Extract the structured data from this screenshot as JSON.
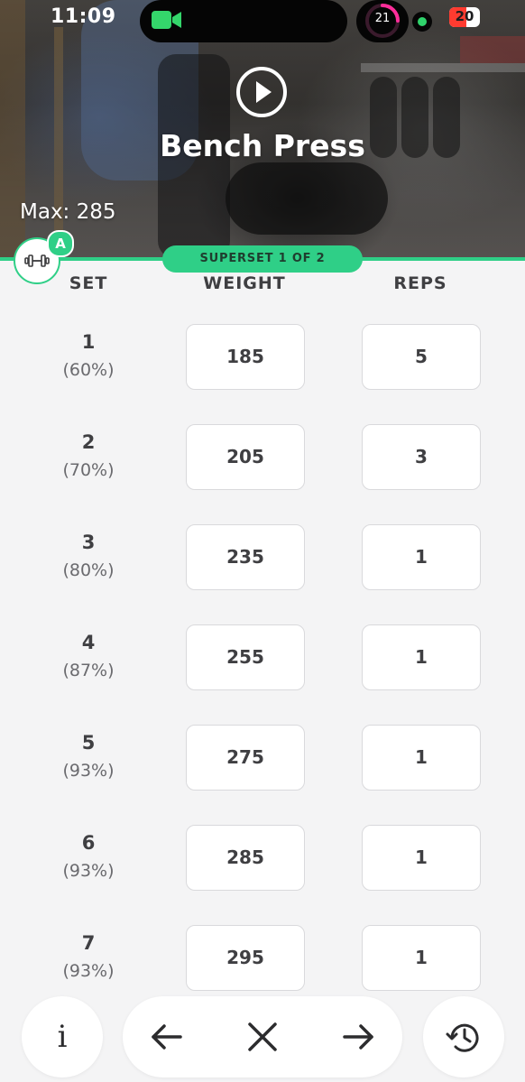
{
  "status_bar": {
    "time": "11:09",
    "activity_count": "21",
    "battery_level": "20",
    "colors": {
      "camera": "#34d66b",
      "ring": "#ff2d9a",
      "battery": "#ff3b30"
    }
  },
  "header": {
    "play_icon": "play-icon",
    "exercise_name": "Bench Press",
    "max_label": "Max: 285"
  },
  "superset": {
    "label": "SUPERSET 1 OF 2",
    "equipment_icon": "dumbbell-icon",
    "badge": "A",
    "accent_color": "#2fcf87"
  },
  "table": {
    "headers": {
      "set": "SET",
      "weight": "WEIGHT",
      "reps": "REPS"
    },
    "rows": [
      {
        "set": "1",
        "percent": "(60%)",
        "weight": "185",
        "reps": "5"
      },
      {
        "set": "2",
        "percent": "(70%)",
        "weight": "205",
        "reps": "3"
      },
      {
        "set": "3",
        "percent": "(80%)",
        "weight": "235",
        "reps": "1"
      },
      {
        "set": "4",
        "percent": "(87%)",
        "weight": "255",
        "reps": "1"
      },
      {
        "set": "5",
        "percent": "(93%)",
        "weight": "275",
        "reps": "1"
      },
      {
        "set": "6",
        "percent": "(93%)",
        "weight": "285",
        "reps": "1"
      },
      {
        "set": "7",
        "percent": "(93%)",
        "weight": "295",
        "reps": "1"
      }
    ]
  },
  "bottom_nav": {
    "info_label": "i",
    "icons": [
      "arrow-left-icon",
      "close-icon",
      "arrow-right-icon",
      "history-icon"
    ]
  }
}
